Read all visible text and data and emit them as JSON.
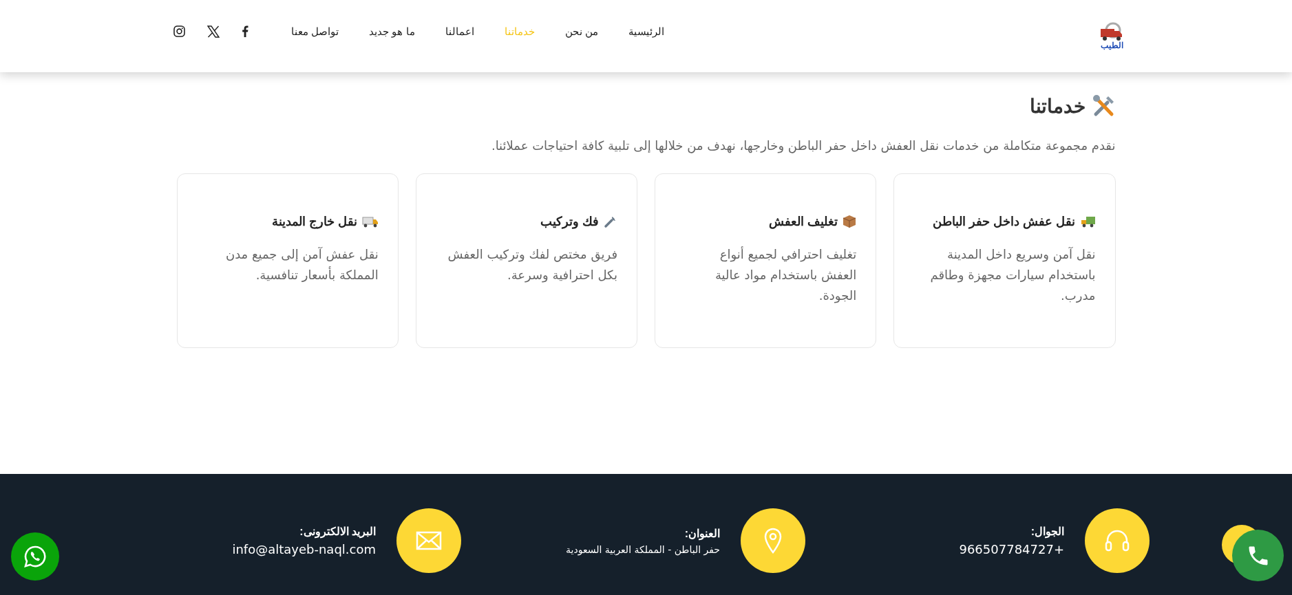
{
  "header": {
    "logo": {
      "text": "الطيب"
    },
    "nav": [
      {
        "label": "الرئيسية",
        "selected": false
      },
      {
        "label": "من نحن",
        "selected": false
      },
      {
        "label": "خدماتنا",
        "selected": true
      },
      {
        "label": "اعمالنا",
        "selected": false
      },
      {
        "label": "ما هو جديد",
        "selected": false
      },
      {
        "label": "تواصل معنا",
        "selected": false
      }
    ],
    "social": [
      {
        "kind": "facebook"
      },
      {
        "kind": "x"
      },
      {
        "kind": "instagram"
      }
    ]
  },
  "services": {
    "title": "خدماتنا",
    "description": "نقدم مجموعة متكاملة من خدمات نقل العفش داخل حفر الباطن وخارجها، نهدف من خلالها إلى تلبية كافة احتياجات عملائنا.",
    "cards": [
      {
        "kind": "truck",
        "title": "نقل عفش داخل حفر الباطن",
        "text": "نقل آمن وسريع داخل المدينة باستخدام سيارات مجهزة وطاقم مدرب."
      },
      {
        "kind": "box",
        "title": "تغليف العفش",
        "text": "تغليف احترافي لجميع أنواع العفش باستخدام مواد عالية الجودة."
      },
      {
        "kind": "wrench",
        "title": "فك وتركيب",
        "text": "فريق مختص لفك وتركيب العفش بكل احترافية وسرعة."
      },
      {
        "kind": "van",
        "title": "نقل خارج المدينة",
        "text": "نقل عفش آمن إلى جميع مدن المملكة بأسعار تنافسية."
      }
    ]
  },
  "footer": {
    "contacts": [
      {
        "kind": "phone",
        "label": "الجوال:",
        "value": "+966507784727"
      },
      {
        "kind": "address",
        "label": "العنوان:",
        "value": "حفر الباطن - المملكة العربية السعودية"
      },
      {
        "kind": "email",
        "label": "البريد الالكترونى:",
        "value": "info@altayeb-naql.com"
      }
    ]
  },
  "floating": [
    {
      "kind": "call"
    },
    {
      "kind": "whatsapp"
    }
  ]
}
